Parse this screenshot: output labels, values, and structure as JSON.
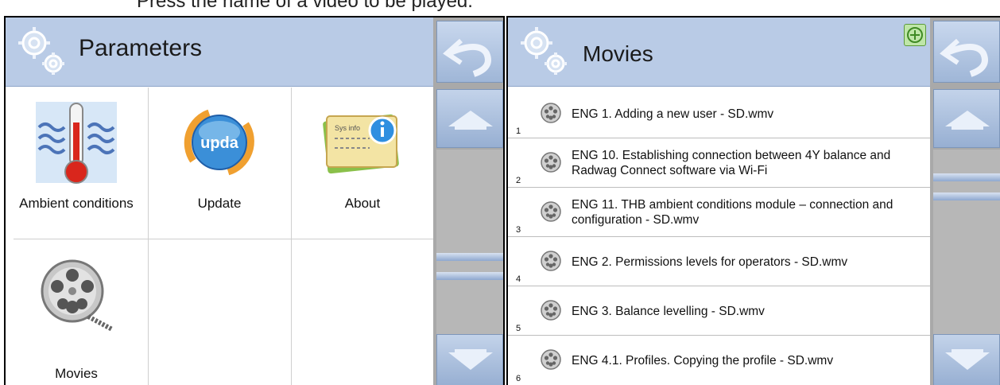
{
  "caption": "Press the name of a video to be played.",
  "left_panel": {
    "title": "Parameters",
    "items": [
      {
        "label": "Ambient conditions",
        "icon": "thermometer-icon"
      },
      {
        "label": "Update",
        "icon": "update-icon"
      },
      {
        "label": "About",
        "icon": "about-icon"
      },
      {
        "label": "Movies",
        "icon": "film-reel-icon"
      }
    ],
    "update_icon_text": "upda",
    "about_icon_text": "Sys info"
  },
  "right_panel": {
    "title": "Movies",
    "movies": [
      {
        "num": "1",
        "name": "ENG 1. Adding a new user - SD.wmv"
      },
      {
        "num": "2",
        "name": "ENG 10. Establishing connection between 4Y balance and Radwag Connect software via Wi-Fi"
      },
      {
        "num": "3",
        "name": "ENG 11. THB ambient conditions module – connection and configuration - SD.wmv"
      },
      {
        "num": "4",
        "name": "ENG 2. Permissions levels for operators - SD.wmv"
      },
      {
        "num": "5",
        "name": "ENG 3. Balance levelling - SD.wmv"
      },
      {
        "num": "6",
        "name": "ENG 4.1. Profiles. Copying the profile - SD.wmv"
      }
    ]
  },
  "colors": {
    "header": "#b9cbe6",
    "sidebar": "#a9a9a9",
    "add": "#bfe6a8"
  }
}
